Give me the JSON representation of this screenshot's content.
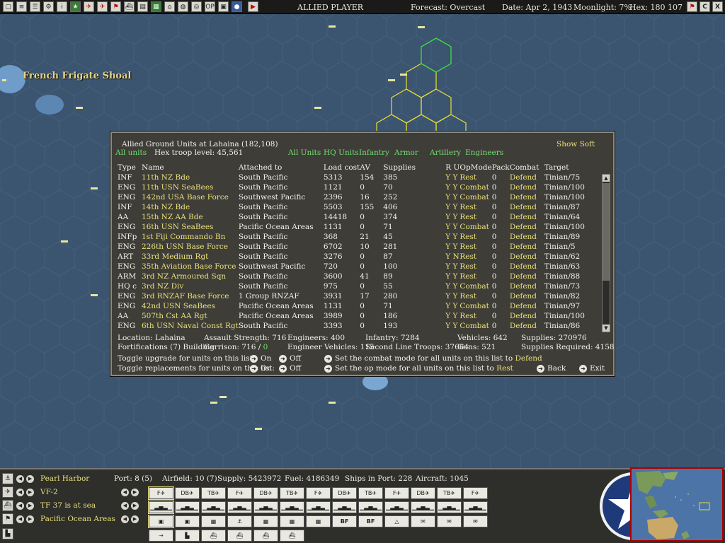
{
  "topbar": {
    "player": "ALLIED PLAYER",
    "forecast": "Forecast: Overcast",
    "date": "Date: Apr 2, 1943",
    "moonlight": "Moonlight: 7%",
    "hex": "Hex: 180 107",
    "right_buttons": [
      "flag-icon",
      "C",
      "X"
    ]
  },
  "map": {
    "labels": [
      "French Frigate Shoal"
    ]
  },
  "dialog": {
    "title": "Allied Ground Units at Lahaina (182,108)",
    "show_soft": "Show Soft",
    "all_units": "All units",
    "hex_troop_level": "Hex troop level: 45,561",
    "filters": [
      "All Units",
      "HQ Units",
      "Infantry",
      "Armor",
      "Artillery",
      "Engineers"
    ],
    "headers": {
      "type": "Type",
      "name": "Name",
      "attached": "Attached to",
      "load": "Load cost",
      "av": "AV",
      "supplies": "Supplies",
      "ru": "R U",
      "opmode": "OpMode",
      "pack": "Pack",
      "combat": "Combat",
      "target": "Target"
    },
    "rows": [
      [
        "INF",
        "11th NZ Bde",
        "South Pacific",
        "5313",
        "154",
        "385",
        "Y Y",
        "Rest",
        "0",
        "Defend",
        "Tinian/75"
      ],
      [
        "ENG",
        "11th USN SeaBees",
        "South Pacific",
        "1121",
        "0",
        "70",
        "Y Y",
        "Combat",
        "0",
        "Defend",
        "Tinian/100"
      ],
      [
        "ENG",
        "142nd USA  Base Force",
        "Southwest Pacific",
        "2396",
        "16",
        "252",
        "Y Y",
        "Combat",
        "0",
        "Defend",
        "Tinian/100"
      ],
      [
        "INF",
        "14th NZ Bde",
        "South Pacific",
        "5503",
        "155",
        "406",
        "Y Y",
        "Rest",
        "0",
        "Defend",
        "Tinian/87"
      ],
      [
        "AA",
        "15th NZ AA Bde",
        "South Pacific",
        "14418",
        "0",
        "374",
        "Y Y",
        "Rest",
        "0",
        "Defend",
        "Tinian/64"
      ],
      [
        "ENG",
        "16th USN SeaBees",
        "Pacific Ocean Areas",
        "1131",
        "0",
        "71",
        "Y Y",
        "Combat",
        "0",
        "Defend",
        "Tinian/100"
      ],
      [
        "INFp",
        "1st Fiji Commando Bn",
        "South Pacific",
        "368",
        "21",
        "45",
        "Y Y",
        "Rest",
        "0",
        "Defend",
        "Tinian/89"
      ],
      [
        "ENG",
        "226th USN Base Force",
        "South Pacific",
        "6702",
        "10",
        "281",
        "Y Y",
        "Rest",
        "0",
        "Defend",
        "Tinian/5"
      ],
      [
        "ART",
        "33rd Medium Rgt",
        "South Pacific",
        "3276",
        "0",
        "87",
        "Y N",
        "Rest",
        "0",
        "Defend",
        "Tinian/62"
      ],
      [
        "ENG",
        "35th Aviation Base Force",
        "Southwest Pacific",
        "720",
        "0",
        "100",
        "Y Y",
        "Rest",
        "0",
        "Defend",
        "Tinian/63"
      ],
      [
        "ARM",
        "3rd NZ Armoured Sqn",
        "South Pacific",
        "3600",
        "41",
        "89",
        "Y Y",
        "Rest",
        "0",
        "Defend",
        "Tinian/88"
      ],
      [
        "HQ c",
        "3rd NZ Div",
        "South Pacific",
        "975",
        "0",
        "55",
        "Y Y",
        "Combat",
        "0",
        "Defend",
        "Tinian/73"
      ],
      [
        "ENG",
        "3rd RNZAF Base Force",
        "1 Group RNZAF",
        "3931",
        "17",
        "280",
        "Y Y",
        "Rest",
        "0",
        "Defend",
        "Tinian/82"
      ],
      [
        "ENG",
        "42nd USN SeaBees",
        "Pacific Ocean Areas",
        "1131",
        "0",
        "71",
        "Y Y",
        "Combat",
        "0",
        "Defend",
        "Tinian/97"
      ],
      [
        "AA",
        "507th Cst AA Rgt",
        "Pacific Ocean Areas",
        "3989",
        "0",
        "186",
        "Y Y",
        "Rest",
        "0",
        "Defend",
        "Tinian/100"
      ],
      [
        "ENG",
        "6th USN Naval Const Rgt",
        "South Pacific",
        "3393",
        "0",
        "193",
        "Y Y",
        "Combat",
        "0",
        "Defend",
        "Tinian/86"
      ]
    ],
    "summary": {
      "location": "Location: Lahaina",
      "assault": "Assault Strength: 716",
      "engineers": "Engineers: 400",
      "infantry": "Infantry: 7284",
      "vehicles": "Vehicles: 642",
      "supplies": "Supplies: 270976",
      "fortifications": "Fortifications (7) Building",
      "garrison_label": "Garrison: 716 / ",
      "garrison_value": "0",
      "eng_vehicles": "Engineer Vehicles: 115",
      "second_line": "Second Line Troops: 37664",
      "guns": "Guns: 521",
      "supplies_req": "Supplies Required: 4158"
    },
    "controls": {
      "toggle_upgrade": "Toggle upgrade for units on this list:",
      "toggle_replace": "Toggle replacements for units on this list:",
      "on": "On",
      "off": "Off",
      "set_combat": "Set the combat mode for all units on this list to",
      "combat_value": "Defend",
      "set_op": "Set the op mode for all units on this list to",
      "op_value": "Rest",
      "back": "Back",
      "exit": "Exit"
    }
  },
  "bottom": {
    "base": "Pearl Harbor",
    "port": "Port: 8 (5)",
    "airfield": "Airfield: 10 (7)",
    "supply": "Supply: 5423972",
    "fuel": "Fuel: 4186349",
    "ships": "Ships in Port: 228",
    "aircraft": "Aircraft: 1045",
    "air_unit": "VF-2",
    "task_force": "TF 37 is at sea",
    "hq": "Pacific Ocean Areas",
    "air_slots": [
      "F",
      "DB",
      "TB",
      "F",
      "DB",
      "TB",
      "F",
      "DB",
      "TB",
      "F",
      "DB",
      "TB",
      "F"
    ],
    "action_labels": [
      "BF",
      "BF"
    ]
  }
}
